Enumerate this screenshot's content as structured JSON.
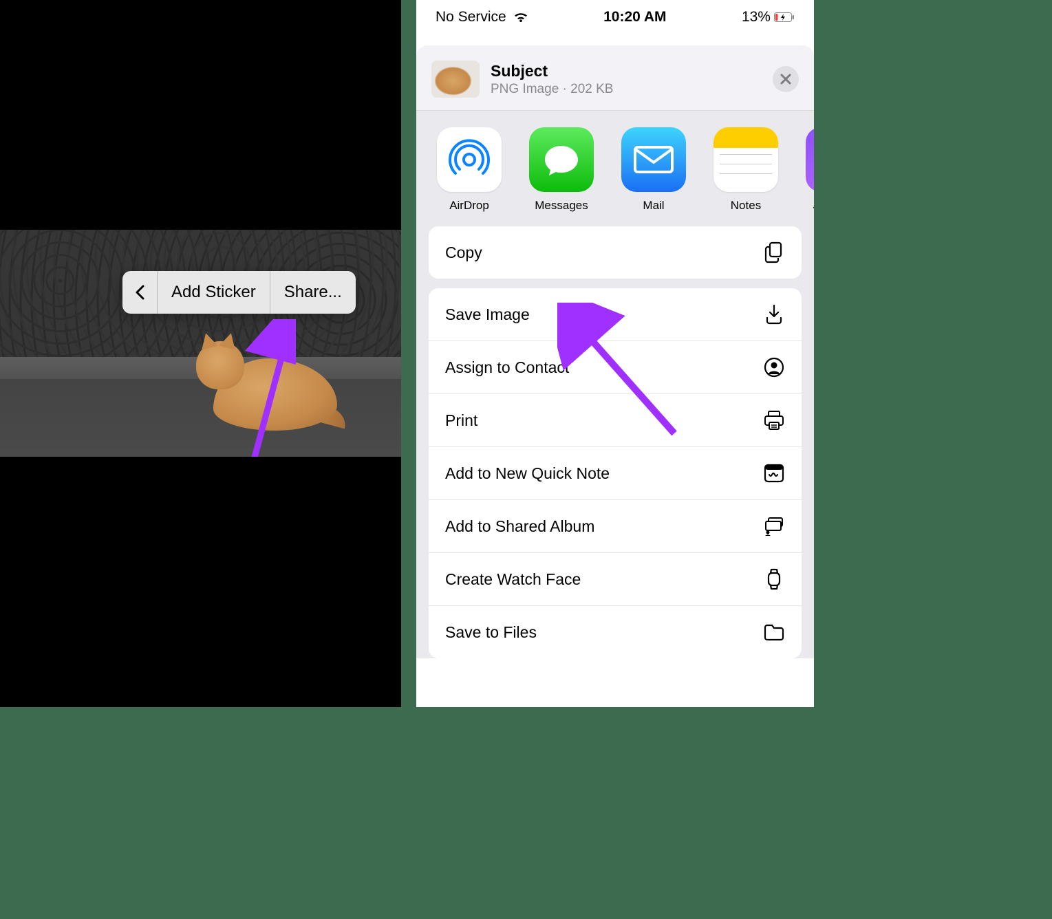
{
  "left": {
    "popup": {
      "back_icon": "‹",
      "add_sticker": "Add Sticker",
      "share": "Share..."
    }
  },
  "right": {
    "status": {
      "carrier": "No Service",
      "time": "10:20 AM",
      "battery_pct": "13%"
    },
    "header": {
      "title": "Subject",
      "subtitle": "PNG Image · 202 KB"
    },
    "apps": [
      {
        "label": "AirDrop"
      },
      {
        "label": "Messages"
      },
      {
        "label": "Mail"
      },
      {
        "label": "Notes"
      },
      {
        "label": "J"
      }
    ],
    "actions": {
      "group1": [
        {
          "label": "Copy"
        }
      ],
      "group2": [
        {
          "label": "Save Image"
        },
        {
          "label": "Assign to Contact"
        },
        {
          "label": "Print"
        },
        {
          "label": "Add to New Quick Note"
        },
        {
          "label": "Add to Shared Album"
        },
        {
          "label": "Create Watch Face"
        },
        {
          "label": "Save to Files"
        }
      ]
    }
  }
}
